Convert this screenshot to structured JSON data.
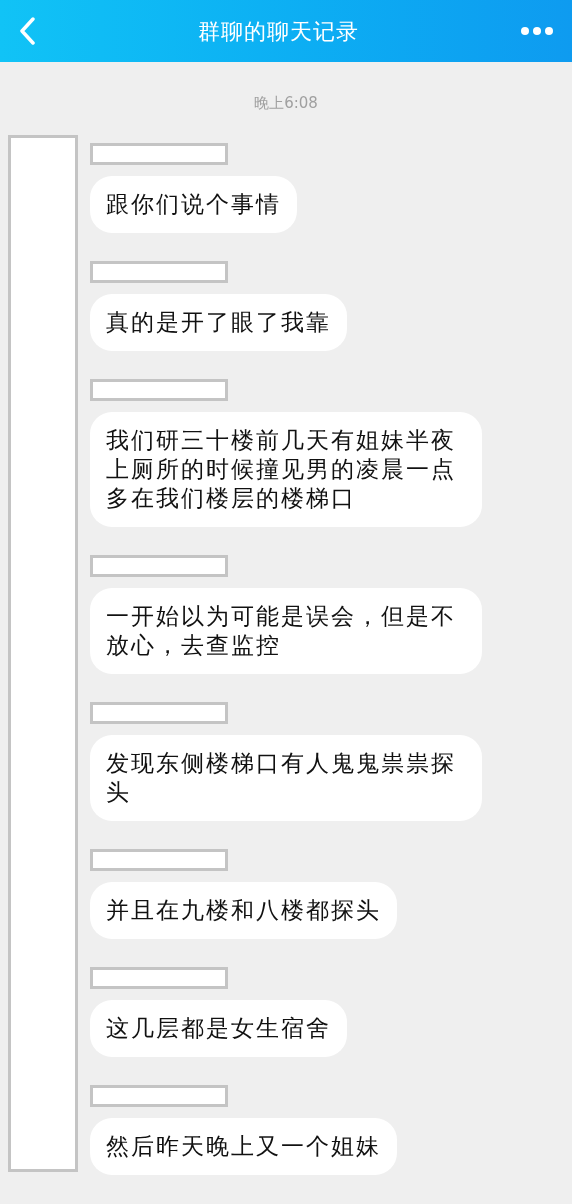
{
  "header": {
    "title": "群聊的聊天记录"
  },
  "timestamp": "晚上6:08",
  "messages": [
    {
      "text": "跟你们说个事情"
    },
    {
      "text": "真的是开了眼了我靠"
    },
    {
      "text": "我们研三十楼前几天有姐妹半夜上厕所的时候撞见男的凌晨一点多在我们楼层的楼梯口"
    },
    {
      "text": "一开始以为可能是误会，但是不放心，去查监控"
    },
    {
      "text": "发现东侧楼梯口有人鬼鬼祟祟探头"
    },
    {
      "text": "并且在九楼和八楼都探头"
    },
    {
      "text": "这几层都是女生宿舍"
    },
    {
      "text": "然后昨天晚上又一个姐妹"
    }
  ]
}
